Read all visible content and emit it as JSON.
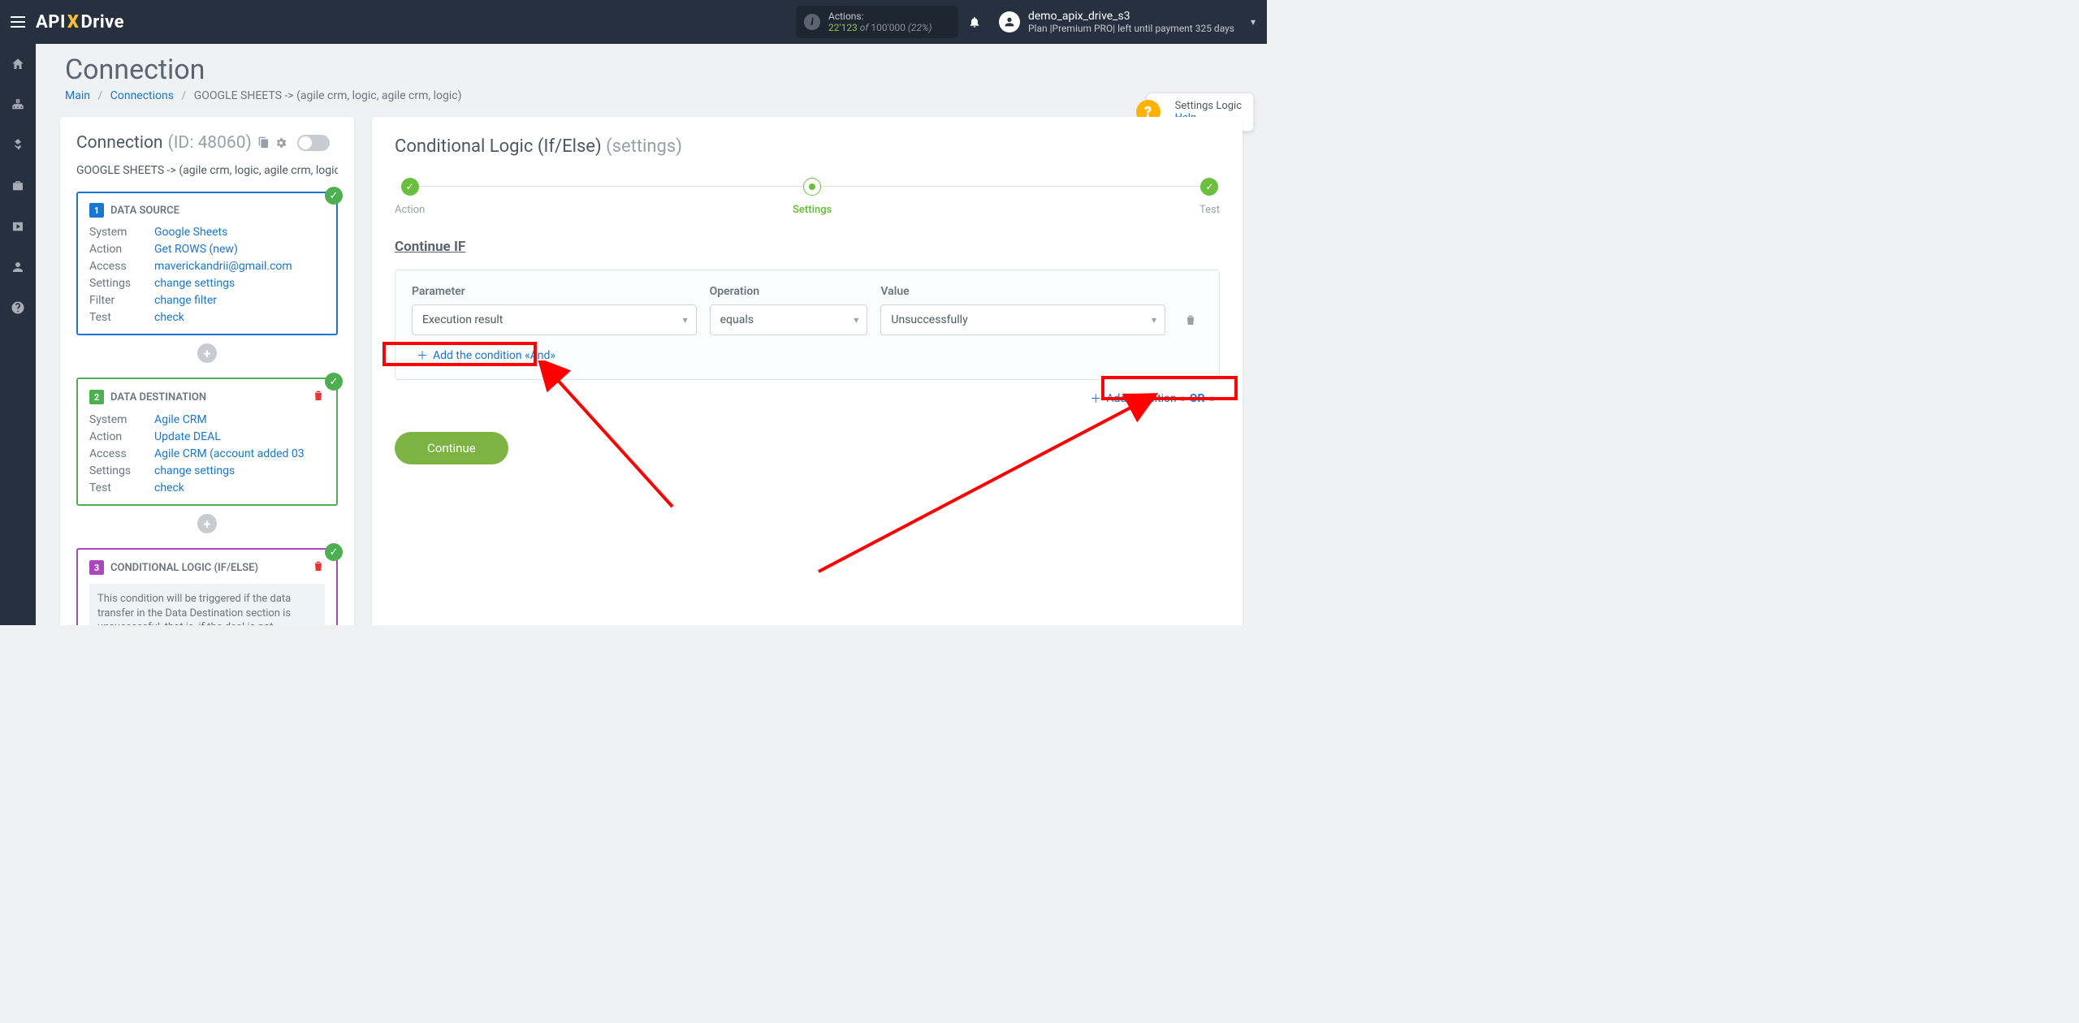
{
  "header": {
    "actions_label": "Actions:",
    "actions_used": "22'123",
    "actions_of": " of ",
    "actions_total": "100'000",
    "actions_pct": " (22%)",
    "username": "demo_apix_drive_s3",
    "plan_line": "Plan |Premium PRO| left until payment 325 days"
  },
  "page": {
    "title": "Connection",
    "breadcrumb": {
      "main": "Main",
      "connections": "Connections",
      "current": "GOOGLE SHEETS -> (agile crm, logic, agile crm, logic)"
    }
  },
  "left": {
    "title": "Connection ",
    "id_label": "(ID: 48060)",
    "sub": "GOOGLE SHEETS -> (agile crm, logic, agile crm, logic)",
    "add_plus": "+",
    "step1": {
      "num": "1",
      "title": "DATA SOURCE",
      "rows": [
        {
          "k": "System",
          "v": "Google Sheets",
          "link": true
        },
        {
          "k": "Action",
          "v": "Get ROWS (new)",
          "link": true
        },
        {
          "k": "Access",
          "v": "maverickandrii@gmail.com",
          "link": true
        },
        {
          "k": "Settings",
          "v": "change settings",
          "link": true
        },
        {
          "k": "Filter",
          "v": "change filter",
          "link": true
        },
        {
          "k": "Test",
          "v": "check",
          "link": true
        }
      ]
    },
    "step2": {
      "num": "2",
      "title": "DATA DESTINATION",
      "rows": [
        {
          "k": "System",
          "v": "Agile CRM",
          "link": true
        },
        {
          "k": "Action",
          "v": "Update DEAL",
          "link": true
        },
        {
          "k": "Access",
          "v": "Agile CRM (account added 03",
          "link": true
        },
        {
          "k": "Settings",
          "v": "change settings",
          "link": true
        },
        {
          "k": "Test",
          "v": "check",
          "link": true
        }
      ]
    },
    "step3": {
      "num": "3",
      "title": "CONDITIONAL LOGIC (IF/ELSE)",
      "desc": "This condition will be triggered if the data transfer in the Data Destination section is unsuccessful, that is, if the deal is not"
    }
  },
  "right": {
    "title": "Conditional Logic (If/Else) ",
    "title_sub": "(settings)",
    "steps": {
      "action": "Action",
      "settings": "Settings",
      "test": "Test"
    },
    "section": "Continue IF",
    "labels": {
      "parameter": "Parameter",
      "operation": "Operation",
      "value": "Value"
    },
    "values": {
      "parameter": "Execution result",
      "operation": "equals",
      "value": "Unsuccessfully"
    },
    "add_and": "Add the condition «And»",
    "add_or_prefix": "Add condition «",
    "add_or_bold": "OR",
    "add_or_suffix": "»",
    "continue": "Continue"
  },
  "help": {
    "title": "Settings Logic",
    "link": "Help"
  }
}
